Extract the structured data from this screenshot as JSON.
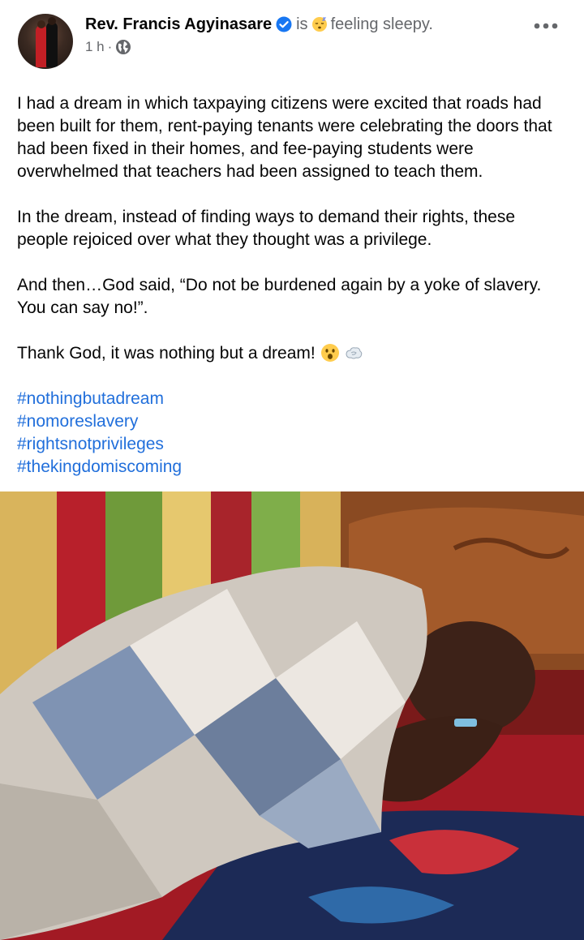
{
  "post": {
    "author": "Rev. Francis Agyinasare",
    "is_text": "is",
    "feeling": "feeling sleepy.",
    "time": "1 h",
    "dot": "·",
    "paragraphs": [
      "I had a dream in which taxpaying citizens were excited that roads had been built for them, rent-paying tenants were celebrating the doors that had been fixed in their homes, and fee-paying students were overwhelmed that teachers had been assigned to teach them.",
      "In the dream, instead of finding ways to demand their rights, these people rejoiced over what they thought was a privilege.",
      "And then…God said, “Do not be burdened again by a yoke of slavery. You can say no!”."
    ],
    "closing": "Thank God, it was nothing but a dream!",
    "hashtags": [
      "#nothingbutadream",
      "#nomoreslavery",
      "#rightsnotprivileges",
      "#thekingdomiscoming"
    ]
  },
  "icons": {
    "verified": "verified-badge-icon",
    "feeling": "sleepy-emoji-icon",
    "audience": "globe-icon",
    "menu": "more-options-icon",
    "closing_emojis": [
      "astonished-face-emoji",
      "dash-emoji"
    ]
  },
  "colors": {
    "link": "#216fdb",
    "verified": "#1877f2",
    "secondary_text": "#65676b"
  }
}
